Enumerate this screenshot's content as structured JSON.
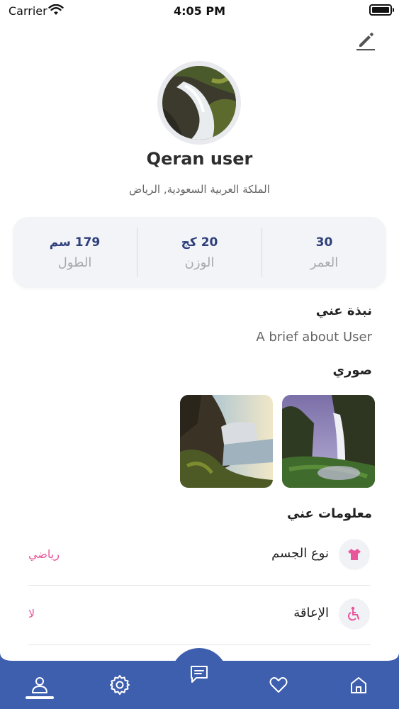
{
  "status_bar": {
    "carrier": "Carrier",
    "time": "4:05 PM"
  },
  "profile": {
    "name": "Qeran user",
    "location": "الملكة العربية السعودية, الرياض"
  },
  "stats": [
    {
      "value": "30",
      "label": "العمر"
    },
    {
      "value": "20 كج",
      "label": "الوزن"
    },
    {
      "value": "179 سم",
      "label": "الطول"
    }
  ],
  "about": {
    "title": "نبذة عني",
    "text": "A brief about User"
  },
  "photos": {
    "title": "صوري"
  },
  "info": {
    "title": "معلومات عني",
    "rows": [
      {
        "label": "نوع الجسم",
        "value": "رياضي",
        "icon": "shirt-icon"
      },
      {
        "label": "الإعاقة",
        "value": "لا",
        "icon": "wheelchair-icon"
      }
    ]
  },
  "nav": {
    "items": [
      "profile-icon",
      "settings-icon",
      "chat-icon",
      "heart-icon",
      "home-icon"
    ],
    "active": "profile",
    "color": "#3e5fae"
  },
  "colors": {
    "accent": "#e8559b",
    "stat_value": "#2e3f7a",
    "nav": "#3e5fae"
  }
}
